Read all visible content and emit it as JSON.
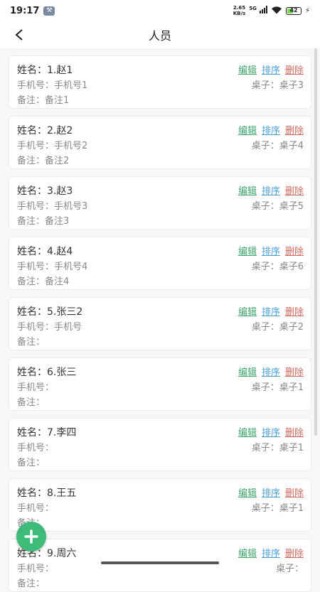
{
  "status": {
    "time": "19:17",
    "net_speed_value": "2.65",
    "net_speed_unit": "KB/s",
    "network": "5G",
    "battery": "42"
  },
  "header": {
    "title": "人员"
  },
  "labels": {
    "name_prefix": "姓名：",
    "phone_prefix": "手机号：",
    "note_prefix": "备注：",
    "table_prefix": "桌子：",
    "edit": "编辑",
    "sort": "排序",
    "delete": "删除"
  },
  "people": [
    {
      "name": "1.赵1",
      "phone": "手机号1",
      "note": "备注1",
      "table": "桌子3"
    },
    {
      "name": "2.赵2",
      "phone": "手机号2",
      "note": "备注2",
      "table": "桌子4"
    },
    {
      "name": "3.赵3",
      "phone": "手机号3",
      "note": "备注3",
      "table": "桌子5"
    },
    {
      "name": "4.赵4",
      "phone": "手机号4",
      "note": "备注4",
      "table": "桌子6"
    },
    {
      "name": "5.张三2",
      "phone": "手机号",
      "note": "",
      "table": "桌子2"
    },
    {
      "name": "6.张三",
      "phone": "",
      "note": "",
      "table": "桌子1"
    },
    {
      "name": "7.李四",
      "phone": "",
      "note": "",
      "table": "桌子1"
    },
    {
      "name": "8.王五",
      "phone": "",
      "note": "",
      "table": "桌子1"
    },
    {
      "name": "9.周六",
      "phone": "",
      "note": "",
      "table": ""
    }
  ],
  "colors": {
    "edit": "#3fa66f",
    "sort": "#4a9fd8",
    "delete": "#d46a5f",
    "fab": "#3dbb78"
  },
  "icons": {
    "back": "chevron-left-icon",
    "fab": "plus-icon"
  }
}
